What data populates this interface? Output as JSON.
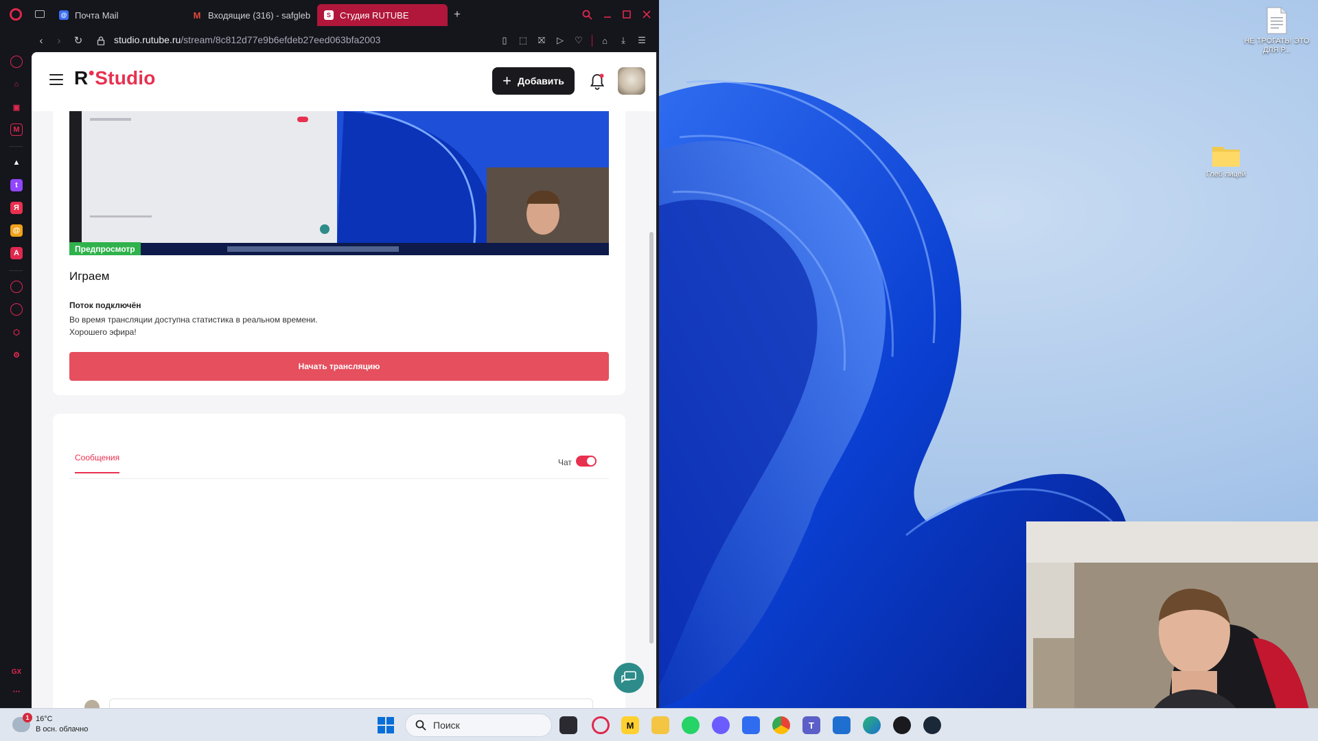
{
  "browser": {
    "tabs": [
      {
        "label": "Почта Mail",
        "icon": "mail-icon",
        "active": false
      },
      {
        "label": "Входящие (316) - safgleb",
        "icon": "gmail-icon",
        "active": false
      },
      {
        "label": "Студия RUTUBE",
        "icon": "rutube-studio-icon",
        "active": true
      }
    ],
    "url_host": "studio.rutube.ru",
    "url_path": "/stream/8c812d77e9b6efdeb27eed063bfa2003",
    "new_tab_label": "+"
  },
  "studio": {
    "logo_r": "R",
    "logo_text": "Studio",
    "add_button_label": "Добавить",
    "preview_badge": "Предпросмотр",
    "stream_title": "Играем",
    "stream_status": "Поток подключён",
    "stream_desc_line1": "Во время трансляции доступна статистика в реальном времени.",
    "stream_desc_line2": "Хорошего эфира!",
    "start_button_label": "Начать трансляцию",
    "messages_tab_label": "Сообщения",
    "chat_toggle_label": "Чат",
    "chat_enabled": true
  },
  "desktop": {
    "icons": [
      {
        "label": "НЕ ТРОГАТЬ! ЭТО ДЛЯ Р...",
        "icon": "text-file-icon"
      },
      {
        "label": "Глеб лицей",
        "icon": "folder-icon"
      }
    ]
  },
  "taskbar": {
    "weather_temp": "16°C",
    "weather_desc": "В осн. облачно",
    "weather_badge": "1",
    "search_placeholder": "Поиск",
    "apps": [
      "start-icon",
      "task-view-icon",
      "opera-icon",
      "miro-icon",
      "file-explorer-icon",
      "whatsapp-icon",
      "messenger-icon",
      "app-icon",
      "chrome-icon",
      "teams-icon",
      "store-icon",
      "edge-icon",
      "red-app-icon",
      "steam-icon"
    ]
  },
  "colors": {
    "accent": "#e8304f",
    "start_button": "#e54f5e",
    "preview_badge": "#2fb24c",
    "tab_active": "#b0173a"
  }
}
